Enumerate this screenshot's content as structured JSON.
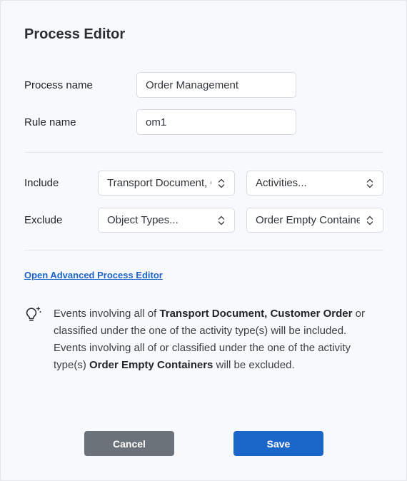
{
  "dialog": {
    "title": "Process Editor",
    "process_name_label": "Process name",
    "process_name_value": "Order Management",
    "rule_name_label": "Rule name",
    "rule_name_value": "om1",
    "include": {
      "label": "Include",
      "object_types_value": "Transport Document, Customer Order",
      "activities_value": "Activities..."
    },
    "exclude": {
      "label": "Exclude",
      "object_types_value": "Object Types...",
      "activities_value": "Order Empty Containers"
    },
    "advanced_link": "Open Advanced Process Editor",
    "hint": {
      "icon": "lightbulb-sparkle-icon",
      "line1_prefix": "Events involving all of ",
      "line1_bold": "Transport Document, Customer Order",
      "line1_suffix": " or classified under the one of the activity type(s) will be included.",
      "line2_prefix": "Events involving all of or classified under the one of the activity type(s) ",
      "line2_bold": "Order Empty Containers",
      "line2_suffix": " will be excluded."
    },
    "cancel_label": "Cancel",
    "save_label": "Save"
  },
  "colors": {
    "primary": "#1b66c9",
    "secondary": "#6b7279",
    "link": "#1c64c8"
  }
}
